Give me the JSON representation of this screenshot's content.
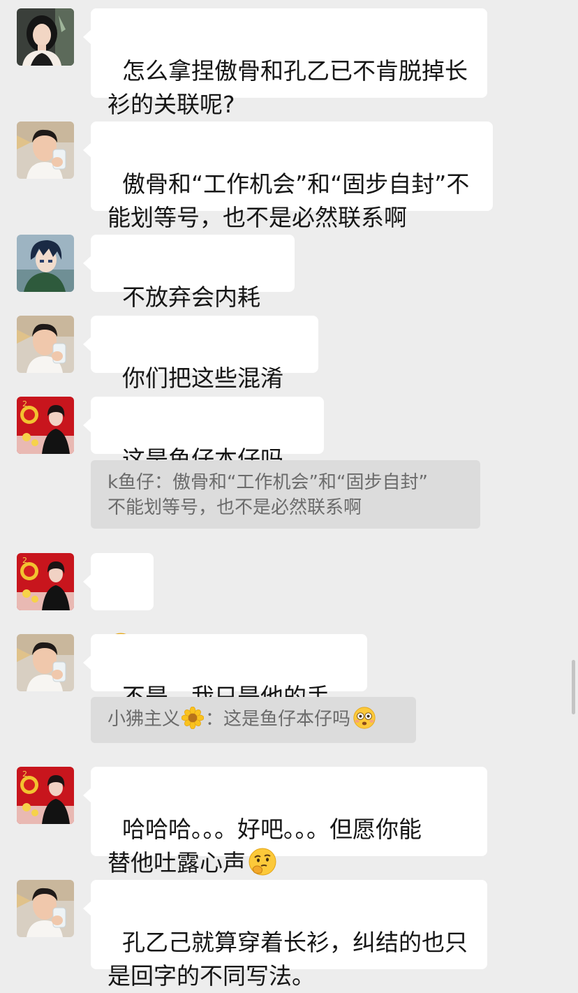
{
  "messages": [
    {
      "avatar": "woman-portrait-avatar",
      "text": "怎么拿捏傲骨和孔乙已不肯脱掉长\n衫的关联呢?"
    },
    {
      "avatar": "man-drinking-avatar",
      "text": "傲骨和“工作机会”和“固步自封”不\n能划等号，也不是必然联系啊"
    },
    {
      "avatar": "anime-boy-avatar",
      "text": "不放弃会内耗吧"
    },
    {
      "avatar": "man-drinking-avatar",
      "text": "你们把这些混淆了"
    },
    {
      "avatar": "new-year-woman-avatar",
      "text": "这是鱼仔本仔吗",
      "emoji": "flushed-face-emoji",
      "quote": {
        "text": "k鱼仔：傲骨和“工作机会”和“固步自封”\n不能划等号，也不是必然联系啊"
      }
    },
    {
      "avatar": "new-year-woman-avatar",
      "text": "",
      "emoji": "thinking-face-emoji"
    },
    {
      "avatar": "man-drinking-avatar",
      "text": "不是，我只是他的手机",
      "quote": {
        "name": "小狒主义",
        "name_emoji": "sunflower-emoji",
        "text": "：这是鱼仔本仔吗",
        "emoji": "flushed-face-emoji"
      }
    },
    {
      "avatar": "new-year-woman-avatar",
      "text": "哈哈哈。。。好吧。。。但愿你能\n替他吐露心声",
      "emoji": "thinking-face-emoji"
    },
    {
      "avatar": "man-drinking-avatar",
      "text": "孔乙己就算穿着长衫，纠结的也只\n是回字的不同写法。"
    }
  ],
  "colors": {
    "background": "#ededed",
    "bubble": "#ffffff",
    "quote_background": "#dcdcdc",
    "quote_text": "#6b6b6b"
  }
}
